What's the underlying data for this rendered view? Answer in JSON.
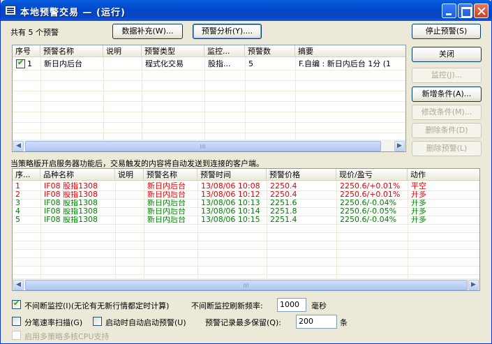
{
  "window": {
    "title": "本地预警交易 — (运行)"
  },
  "top": {
    "count_label": "共有 5 个预警",
    "data_fill_btn": "数据补充(W)...",
    "alert_analysis_btn": "预警分析(Y)....",
    "stop_alert_btn": "停止预警(S)"
  },
  "side_buttons": {
    "close": "关闭",
    "monitor": "监控(J)...",
    "add_condition": "新增条件(A)...",
    "edit_condition": "修改条件(M)...",
    "delete_condition": "删除条件(D)",
    "delete_alert": "删除预警(L)"
  },
  "strategy_list": {
    "columns": [
      "序号",
      "预警名称",
      "说明",
      "预警类型",
      "监控...",
      "预警数",
      "摘要"
    ],
    "rows": [
      {
        "checked": true,
        "no": "1",
        "name": "新日内后台",
        "desc": "",
        "type": "程式化交易",
        "monitor": "股指...",
        "count": "5",
        "summary": "F.自编 : 新日内后台 1分 (1"
      }
    ]
  },
  "info_text": "当策略版开启服务器功能后，交易触发的内容将自动发送到连接的客户端。",
  "alert_list": {
    "columns": [
      "序...",
      "品种名称",
      "说明",
      "预警名称",
      "预警时间",
      "预警价格",
      "现价/盈亏",
      "动作"
    ],
    "rows": [
      {
        "no": "1",
        "product": "IF08 股指1308",
        "desc": "",
        "alert_name": "新日内后台",
        "time": "13/08/06 10:08",
        "price": "2250.4",
        "pnl": "2250.6/+0.01%",
        "action": "平空",
        "color": "red"
      },
      {
        "no": "2",
        "product": "IF08 股指1308",
        "desc": "",
        "alert_name": "新日内后台",
        "time": "13/08/06 10:12",
        "price": "2250.4",
        "pnl": "2250.6/+0.01%",
        "action": "开多",
        "color": "red"
      },
      {
        "no": "3",
        "product": "IF08 股指1308",
        "desc": "",
        "alert_name": "新日内后台",
        "time": "13/08/06 10:13",
        "price": "2251.6",
        "pnl": "2250.6/-0.04%",
        "action": "开多",
        "color": "green"
      },
      {
        "no": "4",
        "product": "IF08 股指1308",
        "desc": "",
        "alert_name": "新日内后台",
        "time": "13/08/06 10:14",
        "price": "2251.8",
        "pnl": "2250.6/-0.05%",
        "action": "开多",
        "color": "green"
      },
      {
        "no": "5",
        "product": "IF08 股指1308",
        "desc": "",
        "alert_name": "新日内后台",
        "time": "13/08/06 10:15",
        "price": "2251.4",
        "pnl": "2250.6/-0.04%",
        "action": "开多",
        "color": "green"
      }
    ]
  },
  "options": {
    "continuous_monitor_label": "不间断监控(I)(无论有无新行情都定时计算)",
    "continuous_monitor_checked": true,
    "refresh_label": "不间断监控刷新频率:",
    "refresh_value": "1000",
    "refresh_unit": "毫秒",
    "tick_scan_label": "分笔速率扫描(G)",
    "tick_scan_checked": false,
    "auto_start_label": "启动时自动启动预警(U)",
    "auto_start_checked": false,
    "max_records_label": "预警记录最多保留(Q):",
    "max_records_value": "200",
    "max_records_unit": "条",
    "multicore_label": "启用多策略多核CPU支持",
    "multicore_checked": false
  },
  "colors": {
    "titlebar": "#0a5fe0",
    "red": "#e00000",
    "green": "#008000"
  }
}
